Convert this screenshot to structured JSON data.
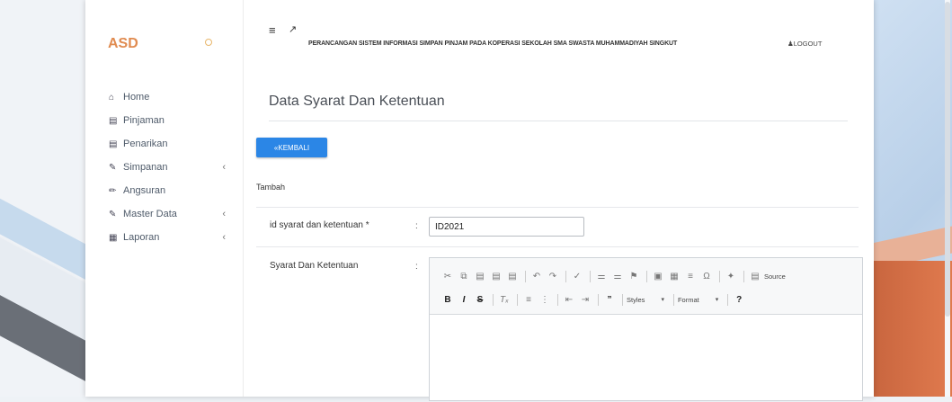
{
  "brand": "ASD",
  "nav": [
    {
      "icon": "home-icon",
      "glyph": "⌂",
      "label": "Home",
      "chevron": ""
    },
    {
      "icon": "table-icon",
      "glyph": "▤",
      "label": "Pinjaman",
      "chevron": ""
    },
    {
      "icon": "table-icon",
      "glyph": "▤",
      "label": "Penarikan",
      "chevron": ""
    },
    {
      "icon": "edit-icon",
      "glyph": "✎",
      "label": "Simpanan",
      "chevron": "‹"
    },
    {
      "icon": "pencil-icon",
      "glyph": "✏",
      "label": "Angsuran",
      "chevron": ""
    },
    {
      "icon": "edit-icon",
      "glyph": "✎",
      "label": "Master Data",
      "chevron": "‹"
    },
    {
      "icon": "calendar-icon",
      "glyph": "▦",
      "label": "Laporan",
      "chevron": "‹"
    }
  ],
  "topbar": {
    "title": "PERANCANGAN SISTEM INFORMASI SIMPAN PINJAM PADA KOPERASI SEKOLAH SMA SWASTA MUHAMMADIYAH SINGKUT",
    "logout": "LOGOUT"
  },
  "page": {
    "title": "Data Syarat Dan Ketentuan",
    "back_button": "«KEMBALI",
    "section": "Tambah"
  },
  "form": {
    "id_label": "id syarat dan ketentuan *",
    "id_value": "ID2021",
    "terms_label": "Syarat Dan Ketentuan",
    "colon": ":"
  },
  "editor": {
    "styles": "Styles",
    "format": "Format",
    "source": "Source",
    "help": "?"
  }
}
